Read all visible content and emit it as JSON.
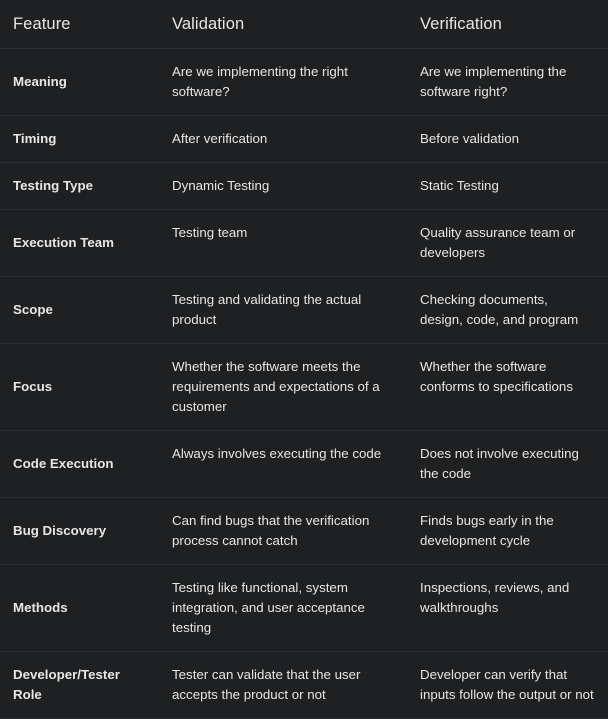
{
  "table": {
    "columns": [
      {
        "key": "feature",
        "label": "Feature"
      },
      {
        "key": "validation",
        "label": "Validation"
      },
      {
        "key": "verification",
        "label": "Verification"
      }
    ],
    "rows": [
      {
        "feature": "Meaning",
        "validation": "Are we implementing the right software?",
        "verification": "Are we implementing the software right?"
      },
      {
        "feature": "Timing",
        "validation": "After verification",
        "verification": "Before validation"
      },
      {
        "feature": "Testing Type",
        "validation": "Dynamic Testing",
        "verification": "Static Testing"
      },
      {
        "feature": "Execution Team",
        "validation": "Testing team",
        "verification": "Quality assurance team or developers"
      },
      {
        "feature": "Scope",
        "validation": "Testing and validating the actual product",
        "verification": "Checking documents, design, code, and program"
      },
      {
        "feature": "Focus",
        "validation": "Whether the software meets the requirements and expectations of a customer",
        "verification": "Whether the software conforms to specifications"
      },
      {
        "feature": "Code Execution",
        "validation": "Always involves executing the code",
        "verification": "Does not involve executing the code"
      },
      {
        "feature": "Bug Discovery",
        "validation": "Can find bugs that the verification process cannot catch",
        "verification": "Finds bugs early in the development cycle"
      },
      {
        "feature": "Methods",
        "validation": "Testing like functional, system integration, and user acceptance testing",
        "verification": "Inspections, reviews, and walkthroughs"
      },
      {
        "feature": "Developer/Tester Role",
        "validation": "Tester can validate that the user accepts the product or not",
        "verification": "Developer can verify that inputs follow the output or not"
      }
    ]
  },
  "theme": {
    "background": "#1f2022",
    "text": "#e8e6e3",
    "divider": "#2b2d30",
    "header_divider": "#2e3033"
  }
}
